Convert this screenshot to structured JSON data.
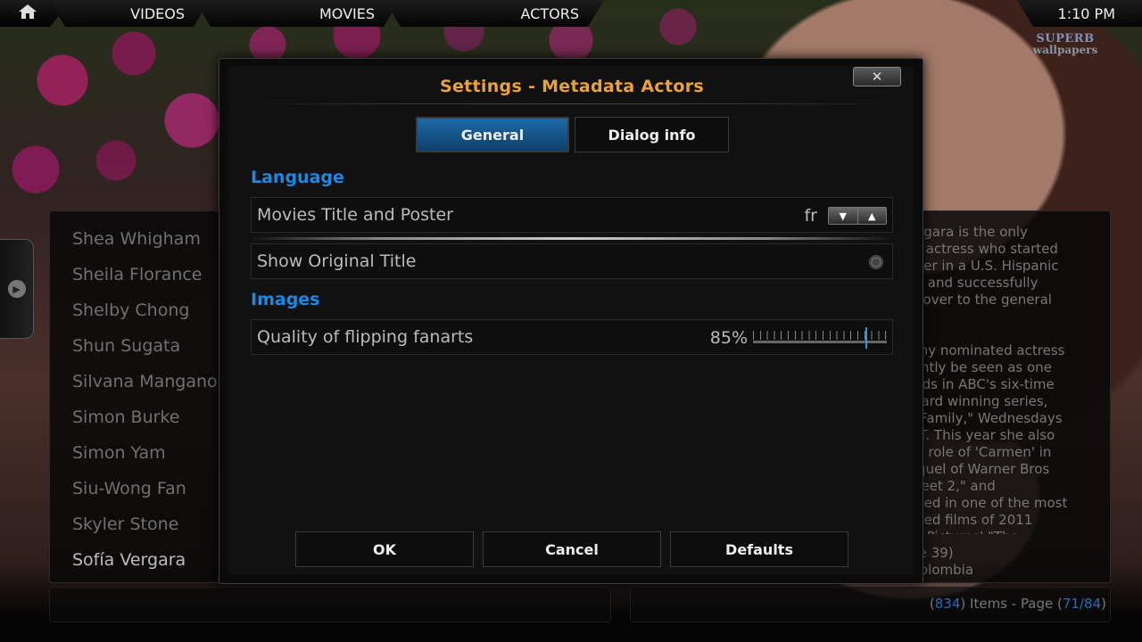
{
  "topbar": {
    "nav": [
      "VIDEOS",
      "MOVIES",
      "ACTORS"
    ],
    "clock": "1:10 PM",
    "home_icon": "home-icon"
  },
  "watermark": {
    "line1": "SUPERB",
    "line2": "wallpapers"
  },
  "actors_list": {
    "items": [
      "Shea Whigham",
      "Sheila Florance",
      "Shelby Chong",
      "Shun Sugata",
      "Silvana Mangano",
      "Simon Burke",
      "Simon Yam",
      "Siu-Wong Fan",
      "Skyler Stone",
      "Sofía Vergara"
    ],
    "selected_index": 9
  },
  "info_panel": {
    "bio": "Vergara is the only\nnic actress who started\nareer in a U.S. Hispanic\nork and successfully\ned over to the general\nt.\n\nmmy nominated actress\nrrently be seen as one\nleads in ABC's six-time\naward winning series,\nrn Family,\" Wednesdays\nEST. This year she also\nthe role of 'Carmen' in\nsequel of Warner Bros\ny Feet 2,\" and\npated in one of the most\npated films of 2011\nbia Pictures' \"The",
    "birth_line1": "age 39)",
    "birth_line2": ", Colombia",
    "items_count": "834",
    "items_label": "Items - Page",
    "page_current": "71",
    "page_total": "84"
  },
  "dialog": {
    "title": "Settings - Metadata Actors",
    "close_label": "✕",
    "tabs": [
      {
        "label": "General",
        "active": true
      },
      {
        "label": "Dialog info",
        "active": false
      }
    ],
    "sections": [
      {
        "heading": "Language",
        "settings": [
          {
            "label": "Movies Title and Poster",
            "type": "spin",
            "value": "fr"
          },
          {
            "label": "Show Original Title",
            "type": "radio",
            "value": false
          }
        ]
      },
      {
        "heading": "Images",
        "settings": [
          {
            "label": "Quality of flipping fanarts",
            "type": "slider",
            "value": "85%",
            "level": 0.85
          }
        ]
      }
    ],
    "buttons": {
      "ok": "OK",
      "cancel": "Cancel",
      "defaults": "Defaults"
    }
  },
  "colors": {
    "title": "#e9a23b",
    "section_heading": "#1e88e5",
    "active_tab": "#1f6aa6",
    "page_numbers": "#2a6ab8"
  }
}
